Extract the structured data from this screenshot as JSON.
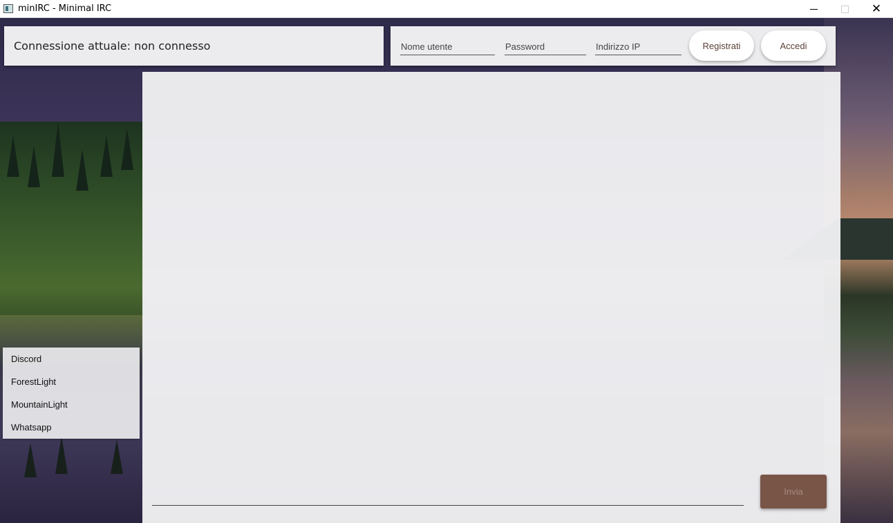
{
  "window": {
    "title": "minIRC - Minimal IRC",
    "minimize_glyph": "",
    "close_glyph": "✕"
  },
  "status": {
    "text": "Connessione attuale: non connesso"
  },
  "login": {
    "username_placeholder": "Nome utente",
    "password_placeholder": "Password",
    "ip_placeholder": "Indirizzo IP",
    "register_label": "Registrati",
    "login_label": "Accedi"
  },
  "chat": {
    "message_value": "",
    "send_label": "Invia"
  },
  "themes": {
    "items": [
      {
        "label": "Discord"
      },
      {
        "label": "ForestLight"
      },
      {
        "label": "MountainLight"
      },
      {
        "label": "Whatsapp"
      }
    ]
  },
  "colors": {
    "accent": "#795548",
    "panel": "#ececee",
    "button_text": "#5d4037"
  }
}
